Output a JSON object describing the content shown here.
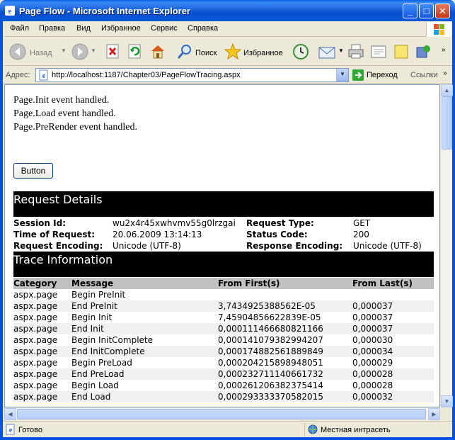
{
  "window": {
    "title": "Page Flow - Microsoft Internet Explorer"
  },
  "menu": [
    "Файл",
    "Правка",
    "Вид",
    "Избранное",
    "Сервис",
    "Справка"
  ],
  "toolbar": {
    "back_label": "Назад",
    "search_label": "Поиск",
    "favorites_label": "Избранное"
  },
  "address": {
    "label": "Адрес:",
    "url": "http://localhost:1187/Chapter03/PageFlowTracing.aspx",
    "go_label": "Переход",
    "links_label": "Ссылки"
  },
  "page": {
    "events": [
      "Page.Init event handled.",
      "Page.Load event handled.",
      "Page.PreRender event handled."
    ],
    "button_label": "Button",
    "request_details": {
      "heading": "Request Details",
      "session_id_label": "Session Id:",
      "session_id": "wu2x4r45xwhvmv55g0lrzgai",
      "request_type_label": "Request Type:",
      "request_type": "GET",
      "time_label": "Time of Request:",
      "time": "20.06.2009 13:14:13",
      "status_label": "Status Code:",
      "status": "200",
      "req_enc_label": "Request Encoding:",
      "req_enc": "Unicode (UTF-8)",
      "resp_enc_label": "Response Encoding:",
      "resp_enc": "Unicode (UTF-8)"
    },
    "trace": {
      "heading": "Trace Information",
      "columns": [
        "Category",
        "Message",
        "From First(s)",
        "From Last(s)"
      ],
      "rows": [
        [
          "aspx.page",
          "Begin PreInit",
          "",
          ""
        ],
        [
          "aspx.page",
          "End PreInit",
          "3,7434925388562E-05",
          "0,000037"
        ],
        [
          "aspx.page",
          "Begin Init",
          "7,45904856622839E-05",
          "0,000037"
        ],
        [
          "aspx.page",
          "End Init",
          "0,000111466680821166",
          "0,000037"
        ],
        [
          "aspx.page",
          "Begin InitComplete",
          "0,000141079382994207",
          "0,000030"
        ],
        [
          "aspx.page",
          "End InitComplete",
          "0,000174882561889849",
          "0,000034"
        ],
        [
          "aspx.page",
          "Begin PreLoad",
          "0,000204215898948051",
          "0,000029"
        ],
        [
          "aspx.page",
          "End PreLoad",
          "0,000232711140661732",
          "0,000028"
        ],
        [
          "aspx.page",
          "Begin Load",
          "0,000261206382375414",
          "0,000028"
        ],
        [
          "aspx.page",
          "End Load",
          "0,000293333370582015",
          "0,000032"
        ]
      ]
    }
  },
  "status": {
    "text": "Готово",
    "zone": "Местная интрасеть"
  }
}
